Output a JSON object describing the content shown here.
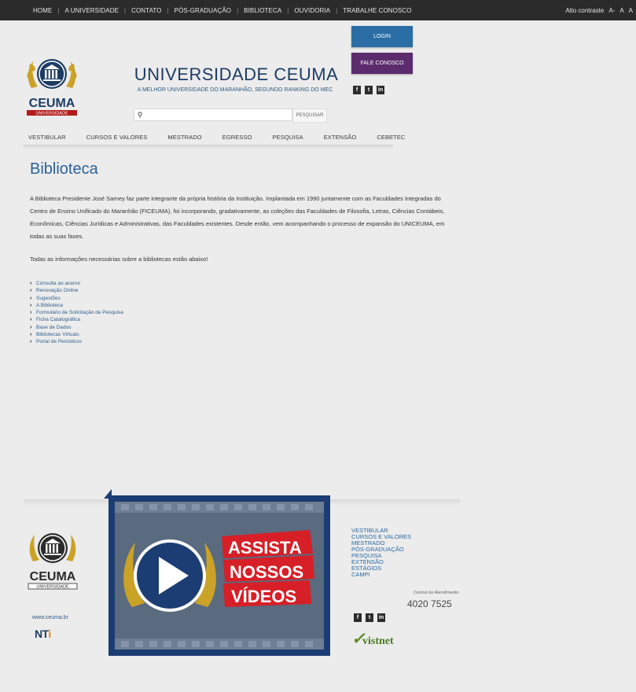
{
  "topnav": {
    "items": [
      "HOME",
      "A UNIVERSIDADE",
      "CONTATO",
      "PÓS-GRADUAÇÃO",
      "BIBLIOTECA",
      "OUVIDORIA",
      "TRABALHE CONOSCO"
    ],
    "separator": "|"
  },
  "accessibility": {
    "contrast_label": "Alto contraste",
    "font_decrease": "A-",
    "font_normal": "A",
    "font_increase": "A"
  },
  "header": {
    "title": "UNIVERSIDADE CEUMA",
    "subtitle": "A MELHOR UNIVERSIDADE DO MARANHÃO, SEGUNDO RANKING DO MEC",
    "login_label": "LOGIN",
    "fale_label": "FALE CONOSCO",
    "logo_text": "CEUMA",
    "logo_sub": "UNIVERSIDADE",
    "social": [
      "f",
      "t",
      "in"
    ]
  },
  "search": {
    "placeholder": "",
    "button_label": "PESQUISAR"
  },
  "mainnav": {
    "items": [
      "VESTIBULAR",
      "CURSOS E VALORES",
      "MESTRADO",
      "EGRESSO",
      "PESQUISA",
      "EXTENSÃO",
      "CEBETEC"
    ]
  },
  "content": {
    "title": "Biblioteca",
    "intro": "A Biblioteca Presidente José Sarney faz parte integrante da própria história da Instituição. Implantada em 1990 juntamente com as Faculdades Integradas do Centro de Ensino Unificado do Maranhão (FICEUMA), foi incorporando, gradativamente, as coleções das Faculdades de Filosofia, Letras, Ciências Contábeis, Econômicas, Ciências Jurídicas e Administrativas, das Faculdades existentes. Desde então, vem acompanhando o processo de expansão do UNICEUMA, em todas as suas fases.",
    "note": "Todas as informações necessárias sobre a bibliotecas estão abaixo!",
    "links": [
      "Consulta ao acervo",
      "Renovação Online",
      "Sugestões",
      "A Biblioteca",
      "Formulário de Solicitação de Pesquisa",
      "Ficha Catalográfica",
      "Base de Dados",
      "Bibliotecas Virtuais",
      "Portal de Periódicos"
    ]
  },
  "footer": {
    "logo_text": "CEUMA",
    "logo_sub": "UNIVERSIDADE",
    "url": "www.ceuma.br",
    "nti_main": "NT",
    "nti_accent": "i",
    "video": {
      "line1": "ASSISTA",
      "line2": "NOSSOS",
      "line3": "VÍDEOS"
    },
    "links": [
      "VESTIBULAR",
      "CURSOS E VALORES",
      "MESTRADO",
      "PÓS-GRADUAÇÃO",
      "PESQUISA",
      "EXTENSÃO",
      "ESTÁGIOS",
      "CAMPI"
    ],
    "central_label": "Central de Atendimento",
    "central_phone": "4020 7525",
    "social": [
      "f",
      "t",
      "in"
    ],
    "partner": "vistnet"
  },
  "colors": {
    "topbar": "#2b2b2b",
    "brand_blue": "#1d3c64",
    "link_blue": "#2c6aa3",
    "login_button": "#2a6ea5",
    "fale_button": "#5c2b6e",
    "gold": "#c9a227",
    "video_red": "#d71f27"
  }
}
